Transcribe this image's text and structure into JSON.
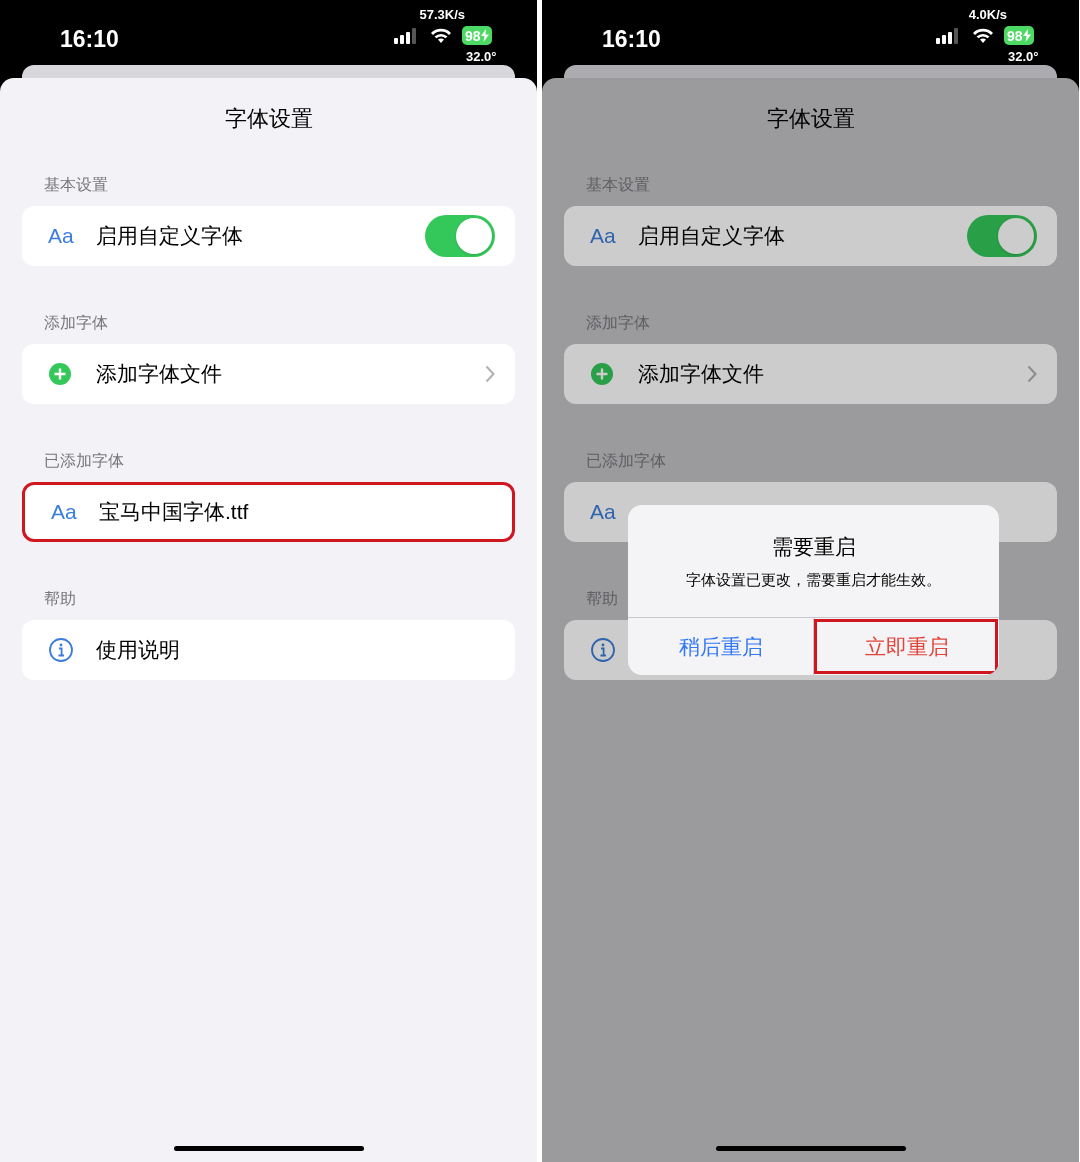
{
  "panels": [
    {
      "status_bar": {
        "time": "16:10",
        "net_speed": "57.3K/s",
        "battery": "98",
        "temperature": "32.0°"
      },
      "title": "字体设置",
      "dimmed": false,
      "sections": [
        {
          "header": "基本设置",
          "rows": [
            {
              "kind": "toggle",
              "icon": "Aa",
              "label": "启用自定义字体",
              "on": true,
              "highlighted": false
            }
          ]
        },
        {
          "header": "添加字体",
          "rows": [
            {
              "kind": "add",
              "label": "添加字体文件",
              "highlighted": false
            }
          ]
        },
        {
          "header": "已添加字体",
          "rows": [
            {
              "kind": "font",
              "icon": "Aa",
              "label": "宝马中国字体.ttf",
              "highlighted": true
            }
          ]
        },
        {
          "header": "帮助",
          "rows": [
            {
              "kind": "info",
              "label": "使用说明",
              "highlighted": false
            }
          ]
        }
      ]
    },
    {
      "status_bar": {
        "time": "16:10",
        "net_speed": "4.0K/s",
        "battery": "98",
        "temperature": "32.0°"
      },
      "title": "字体设置",
      "dimmed": true,
      "sections": [
        {
          "header": "基本设置",
          "rows": [
            {
              "kind": "toggle",
              "icon": "Aa",
              "label": "启用自定义字体",
              "on": true,
              "highlighted": false
            }
          ]
        },
        {
          "header": "添加字体",
          "rows": [
            {
              "kind": "add",
              "label": "添加字体文件",
              "highlighted": false
            }
          ]
        },
        {
          "header": "已添加字体",
          "rows": [
            {
              "kind": "font",
              "icon": "Aa",
              "highlighted": false
            }
          ]
        },
        {
          "header": "帮助",
          "rows": [
            {
              "kind": "info",
              "highlighted": false
            }
          ]
        }
      ],
      "alert": {
        "title": "需要重启",
        "message": "字体设置已更改，需要重启才能生效。",
        "buttons": [
          {
            "label": "稍后重启",
            "kind": "cancel",
            "highlighted": false
          },
          {
            "label": "立即重启",
            "kind": "destructive",
            "highlighted": true
          }
        ]
      }
    }
  ]
}
